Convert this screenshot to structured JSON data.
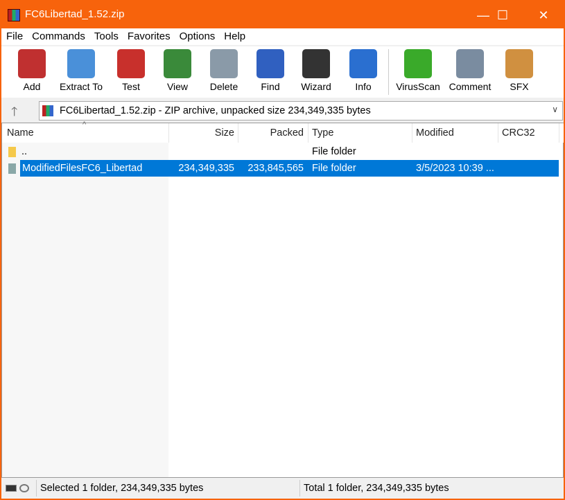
{
  "window": {
    "title": "FC6Libertad_1.52.zip",
    "minimize": "—",
    "maximize": "☐",
    "close": "✕"
  },
  "menu": [
    "File",
    "Commands",
    "Tools",
    "Favorites",
    "Options",
    "Help"
  ],
  "toolbar": [
    {
      "label": "Add",
      "icon": "add-archive-icon",
      "color": "#c03030"
    },
    {
      "label": "Extract To",
      "icon": "extract-folder-icon",
      "color": "#4a90d9"
    },
    {
      "label": "Test",
      "icon": "test-clipboard-icon",
      "color": "#c8302c"
    },
    {
      "label": "View",
      "icon": "book-view-icon",
      "color": "#3a8a3a"
    },
    {
      "label": "Delete",
      "icon": "trash-icon",
      "color": "#8a9aa8"
    },
    {
      "label": "Find",
      "icon": "magnifier-icon",
      "color": "#3060c0"
    },
    {
      "label": "Wizard",
      "icon": "magic-wand-icon",
      "color": "#333333"
    },
    {
      "label": "Info",
      "icon": "info-icon",
      "color": "#2a6fd0"
    },
    {
      "label": "VirusScan",
      "icon": "virus-bug-icon",
      "color": "#3aaa2a"
    },
    {
      "label": "Comment",
      "icon": "comment-icon",
      "color": "#7a8ca0"
    },
    {
      "label": "SFX",
      "icon": "sfx-box-icon",
      "color": "#d09040"
    }
  ],
  "address": {
    "text": "FC6Libertad_1.52.zip - ZIP archive, unpacked size 234,349,335 bytes",
    "up": "🡑",
    "dropdown": "∨"
  },
  "columns": {
    "name": "Name",
    "size": "Size",
    "packed": "Packed",
    "type": "Type",
    "modified": "Modified",
    "crc": "CRC32",
    "sort": "^"
  },
  "rows": [
    {
      "name": "..",
      "size": "",
      "packed": "",
      "type": "File folder",
      "modified": ""
    },
    {
      "name": "ModifiedFilesFC6_Libertad",
      "size": "234,349,335",
      "packed": "233,845,565",
      "type": "File folder",
      "modified": "3/5/2023 10:39 ..."
    }
  ],
  "status": {
    "left": "Selected 1 folder, 234,349,335 bytes",
    "right": "Total 1 folder, 234,349,335 bytes"
  }
}
